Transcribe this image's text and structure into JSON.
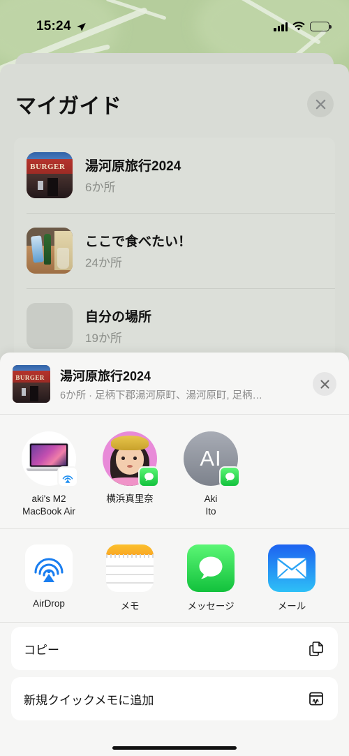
{
  "status_bar": {
    "time": "15:24",
    "location_icon": "location-arrow-icon",
    "cellular_icon": "cellular-signal-icon",
    "wifi_icon": "wifi-icon",
    "battery_icon": "battery-low-power-icon",
    "battery_color": "#f7d038"
  },
  "guides_panel": {
    "title": "マイガイド",
    "close_icon": "close-icon",
    "items": [
      {
        "name": "湯河原旅行2024",
        "count": "6か所",
        "thumb": "burger-shop-photo"
      },
      {
        "name": "ここで食べたい！",
        "count": "24か所",
        "thumb": "table-drinks-photo"
      },
      {
        "name": "自分の場所",
        "count": "19か所",
        "thumb": "placeholder-thumb"
      }
    ]
  },
  "share_sheet": {
    "header": {
      "title": "湯河原旅行2024",
      "subtitle": "6か所 · 足柄下郡湯河原町、湯河原町, 足柄…",
      "thumb": "burger-shop-photo",
      "close_icon": "close-icon"
    },
    "contacts": [
      {
        "name": "aki's M2\nMacBook Air",
        "line1": "aki's M2",
        "line2": "MacBook Air",
        "avatar": "macbook-air-icon",
        "badge": "airdrop-badge-icon"
      },
      {
        "name": "横浜真里奈",
        "line1": "横浜真里奈",
        "line2": "",
        "avatar": "memoji-avatar",
        "badge": "messages-badge-icon"
      },
      {
        "name": "Aki Ito",
        "line1": "Aki",
        "line2": "Ito",
        "avatar": "initials-avatar",
        "initials": "AI",
        "badge": "messages-badge-icon"
      }
    ],
    "apps": [
      {
        "label": "AirDrop",
        "icon": "airdrop-icon"
      },
      {
        "label": "メモ",
        "icon": "notes-icon"
      },
      {
        "label": "メッセージ",
        "icon": "messages-icon"
      },
      {
        "label": "メール",
        "icon": "mail-icon"
      },
      {
        "label": "",
        "icon": "green-app-icon"
      }
    ],
    "actions": [
      {
        "label": "コピー",
        "icon": "copy-icon"
      },
      {
        "label": "新規クイックメモに追加",
        "icon": "quick-note-icon"
      }
    ]
  },
  "colors": {
    "map_green": "#b5cd9c",
    "sheet_bg": "#f6f6f5",
    "dimmed_card": "#d4d7d1",
    "messages_green": "#12c13c",
    "mail_blue": "#1d62f0",
    "airdrop_blue": "#1a8cf0"
  }
}
